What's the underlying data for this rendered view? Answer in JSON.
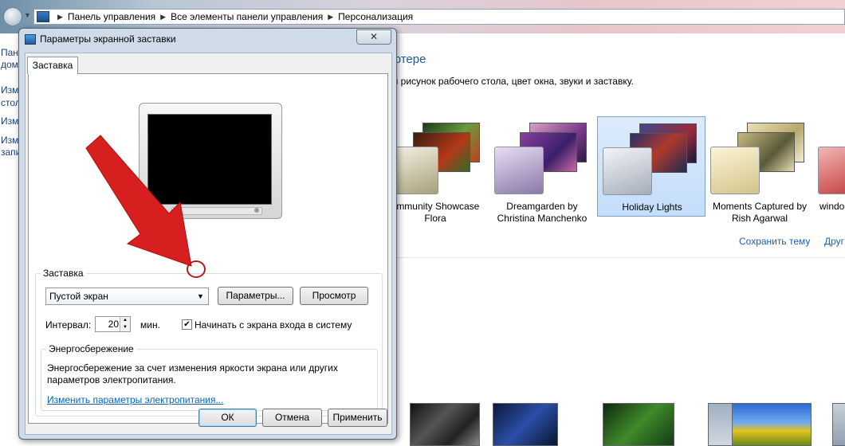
{
  "explorer": {
    "breadcrumbs": [
      "Панель управления",
      "Все элементы панели управления",
      "Персонализация"
    ],
    "left_pane_fragments": [
      "Пан",
      "дом",
      "Изм",
      "стол",
      "Изм",
      "Изм",
      "запи"
    ],
    "content_title": "ьютере",
    "content_desc": "ый рисунок рабочего стола, цвет окна, звуки и заставку.",
    "themes": [
      {
        "line1": "ommunity Showcase",
        "line2": "Flora",
        "selected": false
      },
      {
        "line1": "Dreamgarden by",
        "line2": "Christina Manchenko",
        "selected": false
      },
      {
        "line1": "Holiday Lights",
        "line2": "",
        "selected": true
      },
      {
        "line1": "Moments Captured by",
        "line2": "Rish Agarwal",
        "selected": false
      },
      {
        "line1": "windo",
        "line2": "",
        "selected": false
      }
    ],
    "save_theme_link": "Сохранить тему",
    "other_themes_link": "Друг"
  },
  "dialog": {
    "title": "Параметры экранной заставки",
    "close_label": "✕",
    "tab_label": "Заставка",
    "screensaver_group_label": "Заставка",
    "screensaver_selected": "Пустой экран",
    "params_button": "Параметры...",
    "preview_button": "Просмотр",
    "interval_label": "Интервал:",
    "interval_value": "20",
    "interval_unit": "мин.",
    "logon_checkbox_label": "Начинать с экрана входа в систему",
    "logon_checked": true,
    "power_group_label": "Энергосбережение",
    "power_desc_line1": "Энергосбережение за счет изменения яркости экрана или других",
    "power_desc_line2": "параметров электропитания.",
    "power_link": "Изменить параметры электропитания...",
    "ok_button": "ОК",
    "cancel_button": "Отмена",
    "apply_button": "Применить"
  },
  "colors": {
    "accent_link": "#0a64c0",
    "annotation_arrow": "#d71f1f",
    "selected_theme_bg": "#c4ddfa"
  }
}
